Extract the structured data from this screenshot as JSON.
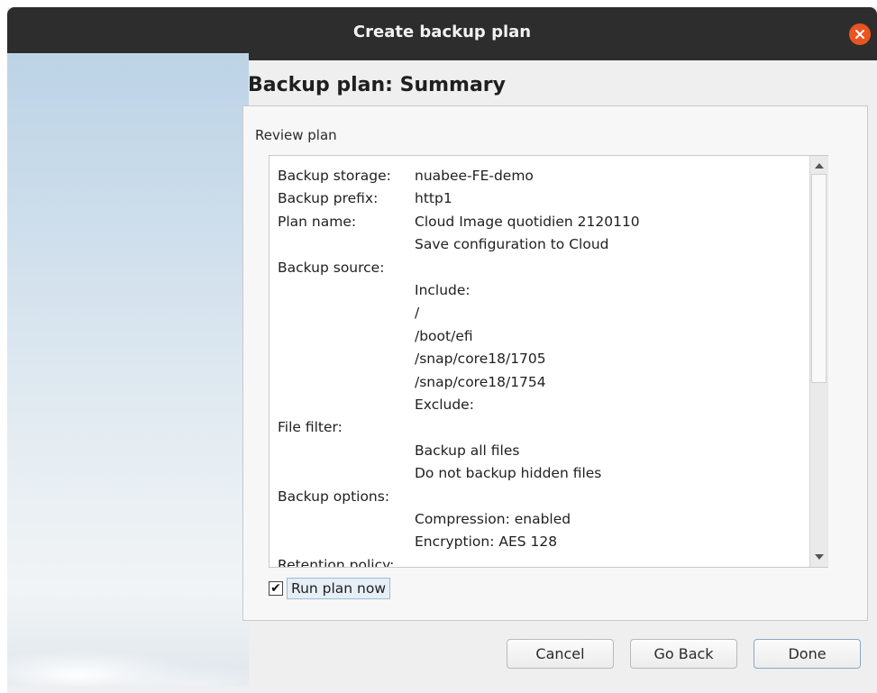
{
  "window": {
    "title": "Create backup plan",
    "close_icon": "close-icon"
  },
  "page": {
    "heading": "Backup plan: Summary",
    "panel_label": "Review plan"
  },
  "review": {
    "rows": [
      {
        "key": "Backup storage:",
        "value": "nuabee-FE-demo"
      },
      {
        "key": "Backup prefix:",
        "value": "http1"
      },
      {
        "key": "Plan name:",
        "value": "Cloud Image quotidien 2120110"
      },
      {
        "key": "",
        "value": "Save configuration to Cloud"
      },
      {
        "key": "Backup source:",
        "value": ""
      },
      {
        "key": "",
        "value": "Include:"
      },
      {
        "key": "",
        "value": "/"
      },
      {
        "key": "",
        "value": "/boot/efi"
      },
      {
        "key": "",
        "value": "/snap/core18/1705"
      },
      {
        "key": "",
        "value": "/snap/core18/1754"
      },
      {
        "key": "",
        "value": "Exclude:"
      },
      {
        "key": "File filter:",
        "value": ""
      },
      {
        "key": "",
        "value": "Backup all files"
      },
      {
        "key": "",
        "value": "Do not backup hidden files"
      },
      {
        "key": "Backup options:",
        "value": ""
      },
      {
        "key": "",
        "value": "Compression: enabled"
      },
      {
        "key": "",
        "value": "Encryption: AES 128"
      },
      {
        "key": "Retention policy:",
        "value": ""
      }
    ]
  },
  "run_now": {
    "label": "Run plan now",
    "checked": true,
    "check_mark": "✔"
  },
  "buttons": {
    "cancel": "Cancel",
    "go_back": "Go Back",
    "done": "Done"
  },
  "colors": {
    "titlebar": "#2d2d2d",
    "close": "#e95420",
    "window_bg": "#efefef"
  }
}
